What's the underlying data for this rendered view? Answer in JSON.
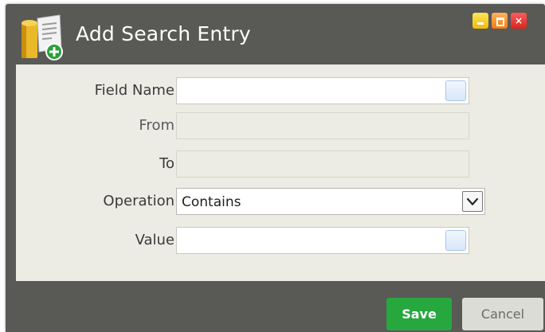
{
  "window": {
    "title": "Add Search Entry",
    "controls": {
      "minimize": "",
      "maximize": "",
      "close": "×"
    }
  },
  "form": {
    "field_name": {
      "label": "Field Name",
      "value": ""
    },
    "from": {
      "label": "From",
      "value": ""
    },
    "to": {
      "label": "To",
      "value": ""
    },
    "operation": {
      "label": "Operation",
      "selected": "Contains"
    },
    "value": {
      "label": "Value",
      "value": ""
    }
  },
  "footer": {
    "save_label": "Save",
    "cancel_label": "Cancel"
  },
  "colors": {
    "dialog_bg": "#595956",
    "panel_bg": "#ecece4",
    "save_bg": "#27a83e",
    "cancel_bg": "#dcdcd6",
    "minimize": "#f0b90c",
    "maximize": "#f27b14",
    "close": "#d8261e"
  },
  "icons": {
    "app": "document-scroll-add-icon",
    "lookup": "lookup-icon",
    "dropdown": "chevron-down-icon"
  }
}
